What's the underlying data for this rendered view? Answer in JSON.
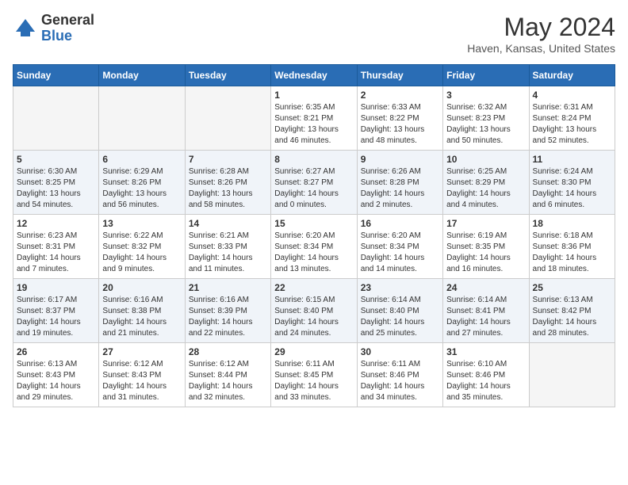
{
  "logo": {
    "general": "General",
    "blue": "Blue"
  },
  "title": "May 2024",
  "location": "Haven, Kansas, United States",
  "days_of_week": [
    "Sunday",
    "Monday",
    "Tuesday",
    "Wednesday",
    "Thursday",
    "Friday",
    "Saturday"
  ],
  "weeks": [
    [
      {
        "day": "",
        "info": ""
      },
      {
        "day": "",
        "info": ""
      },
      {
        "day": "",
        "info": ""
      },
      {
        "day": "1",
        "info": "Sunrise: 6:35 AM\nSunset: 8:21 PM\nDaylight: 13 hours\nand 46 minutes."
      },
      {
        "day": "2",
        "info": "Sunrise: 6:33 AM\nSunset: 8:22 PM\nDaylight: 13 hours\nand 48 minutes."
      },
      {
        "day": "3",
        "info": "Sunrise: 6:32 AM\nSunset: 8:23 PM\nDaylight: 13 hours\nand 50 minutes."
      },
      {
        "day": "4",
        "info": "Sunrise: 6:31 AM\nSunset: 8:24 PM\nDaylight: 13 hours\nand 52 minutes."
      }
    ],
    [
      {
        "day": "5",
        "info": "Sunrise: 6:30 AM\nSunset: 8:25 PM\nDaylight: 13 hours\nand 54 minutes."
      },
      {
        "day": "6",
        "info": "Sunrise: 6:29 AM\nSunset: 8:26 PM\nDaylight: 13 hours\nand 56 minutes."
      },
      {
        "day": "7",
        "info": "Sunrise: 6:28 AM\nSunset: 8:26 PM\nDaylight: 13 hours\nand 58 minutes."
      },
      {
        "day": "8",
        "info": "Sunrise: 6:27 AM\nSunset: 8:27 PM\nDaylight: 14 hours\nand 0 minutes."
      },
      {
        "day": "9",
        "info": "Sunrise: 6:26 AM\nSunset: 8:28 PM\nDaylight: 14 hours\nand 2 minutes."
      },
      {
        "day": "10",
        "info": "Sunrise: 6:25 AM\nSunset: 8:29 PM\nDaylight: 14 hours\nand 4 minutes."
      },
      {
        "day": "11",
        "info": "Sunrise: 6:24 AM\nSunset: 8:30 PM\nDaylight: 14 hours\nand 6 minutes."
      }
    ],
    [
      {
        "day": "12",
        "info": "Sunrise: 6:23 AM\nSunset: 8:31 PM\nDaylight: 14 hours\nand 7 minutes."
      },
      {
        "day": "13",
        "info": "Sunrise: 6:22 AM\nSunset: 8:32 PM\nDaylight: 14 hours\nand 9 minutes."
      },
      {
        "day": "14",
        "info": "Sunrise: 6:21 AM\nSunset: 8:33 PM\nDaylight: 14 hours\nand 11 minutes."
      },
      {
        "day": "15",
        "info": "Sunrise: 6:20 AM\nSunset: 8:34 PM\nDaylight: 14 hours\nand 13 minutes."
      },
      {
        "day": "16",
        "info": "Sunrise: 6:20 AM\nSunset: 8:34 PM\nDaylight: 14 hours\nand 14 minutes."
      },
      {
        "day": "17",
        "info": "Sunrise: 6:19 AM\nSunset: 8:35 PM\nDaylight: 14 hours\nand 16 minutes."
      },
      {
        "day": "18",
        "info": "Sunrise: 6:18 AM\nSunset: 8:36 PM\nDaylight: 14 hours\nand 18 minutes."
      }
    ],
    [
      {
        "day": "19",
        "info": "Sunrise: 6:17 AM\nSunset: 8:37 PM\nDaylight: 14 hours\nand 19 minutes."
      },
      {
        "day": "20",
        "info": "Sunrise: 6:16 AM\nSunset: 8:38 PM\nDaylight: 14 hours\nand 21 minutes."
      },
      {
        "day": "21",
        "info": "Sunrise: 6:16 AM\nSunset: 8:39 PM\nDaylight: 14 hours\nand 22 minutes."
      },
      {
        "day": "22",
        "info": "Sunrise: 6:15 AM\nSunset: 8:40 PM\nDaylight: 14 hours\nand 24 minutes."
      },
      {
        "day": "23",
        "info": "Sunrise: 6:14 AM\nSunset: 8:40 PM\nDaylight: 14 hours\nand 25 minutes."
      },
      {
        "day": "24",
        "info": "Sunrise: 6:14 AM\nSunset: 8:41 PM\nDaylight: 14 hours\nand 27 minutes."
      },
      {
        "day": "25",
        "info": "Sunrise: 6:13 AM\nSunset: 8:42 PM\nDaylight: 14 hours\nand 28 minutes."
      }
    ],
    [
      {
        "day": "26",
        "info": "Sunrise: 6:13 AM\nSunset: 8:43 PM\nDaylight: 14 hours\nand 29 minutes."
      },
      {
        "day": "27",
        "info": "Sunrise: 6:12 AM\nSunset: 8:43 PM\nDaylight: 14 hours\nand 31 minutes."
      },
      {
        "day": "28",
        "info": "Sunrise: 6:12 AM\nSunset: 8:44 PM\nDaylight: 14 hours\nand 32 minutes."
      },
      {
        "day": "29",
        "info": "Sunrise: 6:11 AM\nSunset: 8:45 PM\nDaylight: 14 hours\nand 33 minutes."
      },
      {
        "day": "30",
        "info": "Sunrise: 6:11 AM\nSunset: 8:46 PM\nDaylight: 14 hours\nand 34 minutes."
      },
      {
        "day": "31",
        "info": "Sunrise: 6:10 AM\nSunset: 8:46 PM\nDaylight: 14 hours\nand 35 minutes."
      },
      {
        "day": "",
        "info": ""
      }
    ]
  ]
}
